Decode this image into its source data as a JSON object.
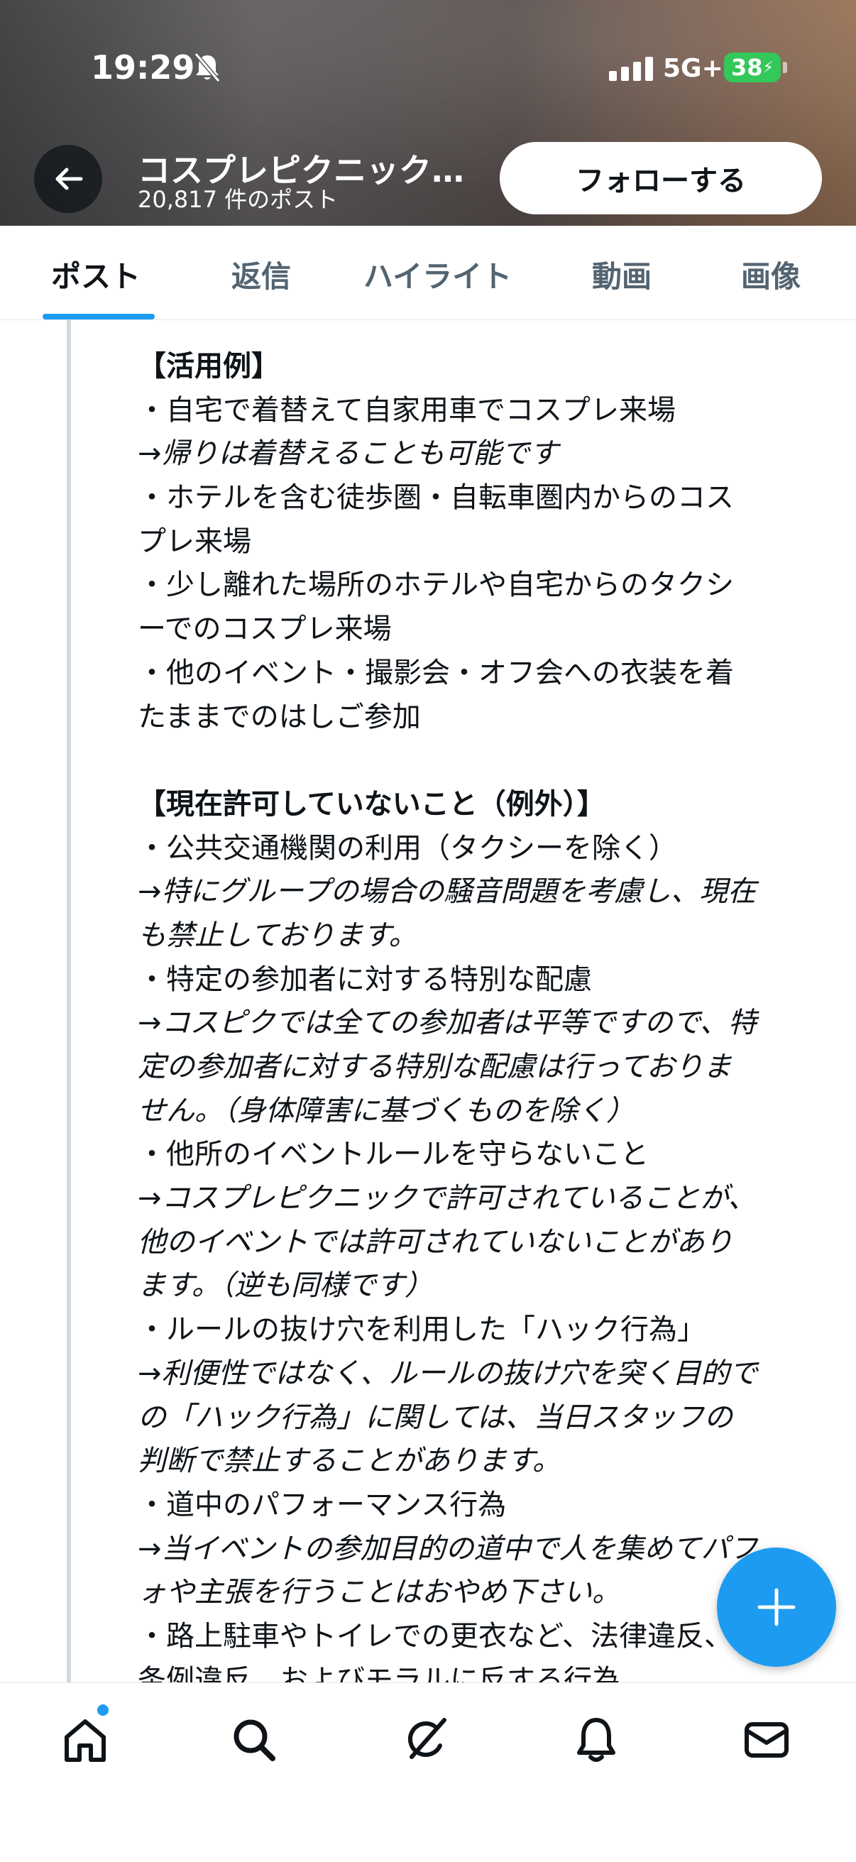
{
  "status_bar": {
    "time": "19:29",
    "network": "5G+",
    "battery": "38"
  },
  "header": {
    "profile_name": "コスプレピクニック公式",
    "post_count": "20,817 件のポスト",
    "follow_label": "フォローする"
  },
  "tabs": [
    {
      "label": "ポスト",
      "active": true
    },
    {
      "label": "返信",
      "active": false
    },
    {
      "label": "ハイライト",
      "active": false
    },
    {
      "label": "動画",
      "active": false
    },
    {
      "label": "画像",
      "active": false
    }
  ],
  "post_lines": [
    "【活用例】",
    "・自宅で着替えて自家用車でコスプレ来場",
    "→帰りは着替えることも可能です",
    "・ホテルを含む徒歩圏・自転車圏内からのコス",
    "プレ来場",
    "・少し離れた場所のホテルや自宅からのタクシ",
    "ーでのコスプレ来場",
    "・他のイベント・撮影会・オフ会への衣装を着",
    "たままでのはしご参加",
    "",
    "【現在許可していないこと（例外）】",
    "・公共交通機関の利用（タクシーを除く）",
    "→特にグループの場合の騒音問題を考慮し、現在",
    "も禁止しております。",
    "・特定の参加者に対する特別な配慮",
    "→コスピクでは全ての参加者は平等ですので、特",
    "定の参加者に対する特別な配慮は行っておりま",
    "せん。（身体障害に基づくものを除く）",
    "・他所のイベントルールを守らないこと",
    "→コスプレピクニックで許可されていることが、",
    "他のイベントでは許可されていないことがあり",
    "ます。（逆も同様です）",
    "・ルールの抜け穴を利用した「ハック行為」",
    "→利便性ではなく、ルールの抜け穴を突く目的で",
    "の「ハック行為」に関しては、当日スタッフの",
    "判断で禁止することがあります。",
    "・道中のパフォーマンス行為",
    "→当イベントの参加目的の道中で人を集めてパフ",
    "ォや主張を行うことはおやめ下さい。",
    "・路上駐車やトイレでの更衣など、法律違反、",
    "条例違反、およびモラルに反する行為"
  ],
  "icons": {
    "back": "arrow-left-icon",
    "compose": "plus-icon",
    "nav": [
      "home-icon",
      "search-icon",
      "grok-icon",
      "bell-icon",
      "mail-icon"
    ]
  },
  "colors": {
    "accent": "#1d9bf0",
    "text": "#0f1419",
    "secondary": "#536471"
  }
}
